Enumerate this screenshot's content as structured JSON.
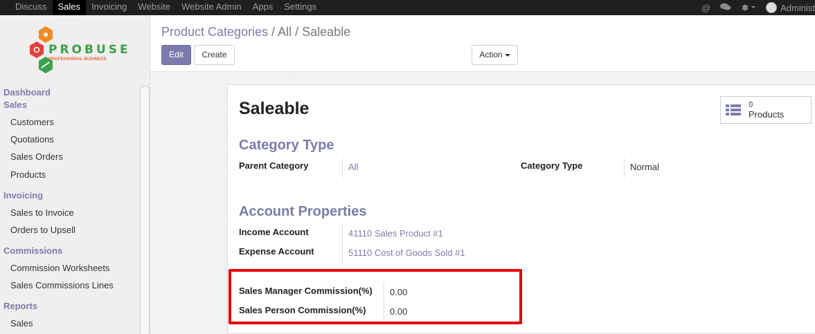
{
  "topbar": {
    "menu": [
      "Discuss",
      "Sales",
      "Invoicing",
      "Website",
      "Website Admin",
      "Apps",
      "Settings"
    ],
    "active": "Sales",
    "user": "Administ",
    "icons": [
      "at-icon",
      "chat-icon",
      "bug-icon",
      "avatar"
    ]
  },
  "logo": {
    "name": "PROBUSE",
    "tagline": "PROFESSIONAL BUSINESS"
  },
  "sidebar": {
    "dashboard": "Dashboard",
    "sales": "Sales",
    "customers": "Customers",
    "quotations": "Quotations",
    "sales_orders": "Sales Orders",
    "products": "Products",
    "invoicing": "Invoicing",
    "sales_to_invoice": "Sales to Invoice",
    "orders_to_upsell": "Orders to Upsell",
    "commissions": "Commissions",
    "commission_worksheets": "Commission Worksheets",
    "sales_commission_lines": "Sales Commissions Lines",
    "reports": "Reports",
    "reports_sales": "Sales"
  },
  "breadcrumb": {
    "root": "Product Categories",
    "sep": "/",
    "current": "All / Saleable"
  },
  "buttons": {
    "edit": "Edit",
    "create": "Create",
    "action": "Action"
  },
  "record": {
    "name": "Saleable",
    "products_count": "0",
    "products_label": "Products",
    "section_category": "Category Type",
    "parent_category_label": "Parent Category",
    "parent_category_value": "All",
    "category_type_label": "Category Type",
    "category_type_value": "Normal",
    "section_account": "Account Properties",
    "income_account_label": "Income Account",
    "income_account_value": "41110 Sales Product #1",
    "expense_account_label": "Expense Account",
    "expense_account_value": "51110 Cost of Goods Sold #1",
    "manager_commission_label": "Sales Manager Commission(%)",
    "manager_commission_value": "0.00",
    "person_commission_label": "Sales Person Commission(%)",
    "person_commission_value": "0.00"
  },
  "colors": {
    "accent": "#7c7bad",
    "highlight": "#e8000b",
    "topbar": "#1f1f1f"
  }
}
